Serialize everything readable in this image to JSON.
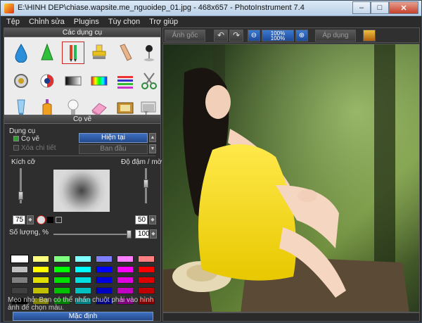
{
  "window": {
    "title": "E:\\HINH DEP\\chiase.wapsite.me_nguoidep_01.jpg - 468x657 - PhotoInstrument 7.4",
    "minimize": "–",
    "maximize": "□",
    "close": "✕"
  },
  "menu": [
    "Tệp",
    "Chỉnh sửa",
    "Plugins",
    "Tùy chọn",
    "Trợ giúp"
  ],
  "tools_panel": {
    "title": "Các dụng cụ",
    "tools": [
      "drop-tool",
      "cone-tool",
      "brush-tool",
      "stamp-tool",
      "finger-tool",
      "pin-tool",
      "lens-tool",
      "eye-tool",
      "gradient-tool",
      "spectrum-tool",
      "lines-tool",
      "scissors-tool",
      "tube-tool",
      "bottle-tool",
      "bulb-tool",
      "eraser-tool",
      "film-tool",
      "text-tool"
    ],
    "selected": "brush-tool"
  },
  "brush_panel": {
    "title": "Cọ vẽ",
    "tool_label": "Dụng cụ",
    "option_brush": "Cọ vẽ",
    "option_erase": "Xóa chi tiết",
    "current_button": "Hiện tại",
    "original_button": "Ban đầu",
    "size_label": "Kích cỡ",
    "opacity_label": "Độ đậm / mờ",
    "size_value": "75",
    "opacity_value": "50",
    "quantity_label": "Số lượng, %",
    "quantity_value": "100",
    "default_button": "Mặc định",
    "hint": "Mẹo nhỏ: Bạn có thể nhấn chuột phải vào hình ảnh để chọn màu."
  },
  "palette": [
    [
      "#ffffff",
      "#ffff80",
      "#80ff80",
      "#80ffff",
      "#8080ff",
      "#ff80ff",
      "#ff8080"
    ],
    [
      "#c0c0c0",
      "#ffff00",
      "#00ff00",
      "#00ffff",
      "#0000ff",
      "#ff00ff",
      "#ff0000"
    ],
    [
      "#808080",
      "#e0e000",
      "#00e000",
      "#00e0e0",
      "#0000e0",
      "#e000e0",
      "#e00000"
    ],
    [
      "#404040",
      "#c0c000",
      "#00c000",
      "#00c0c0",
      "#0000c0",
      "#c000c0",
      "#c00000"
    ],
    [
      "#000000",
      "#808000",
      "#008000",
      "#008080",
      "#000080",
      "#800080",
      "#800000"
    ]
  ],
  "toolbar": {
    "original_button": "Ảnh gốc",
    "apply_button": "Áp dụng",
    "zoom_text_top": "100%",
    "zoom_text_bottom": "100%"
  },
  "colors": {
    "accent": "#2d5aa8",
    "dress": "#f2d80a",
    "background": "#1c1c1c"
  }
}
